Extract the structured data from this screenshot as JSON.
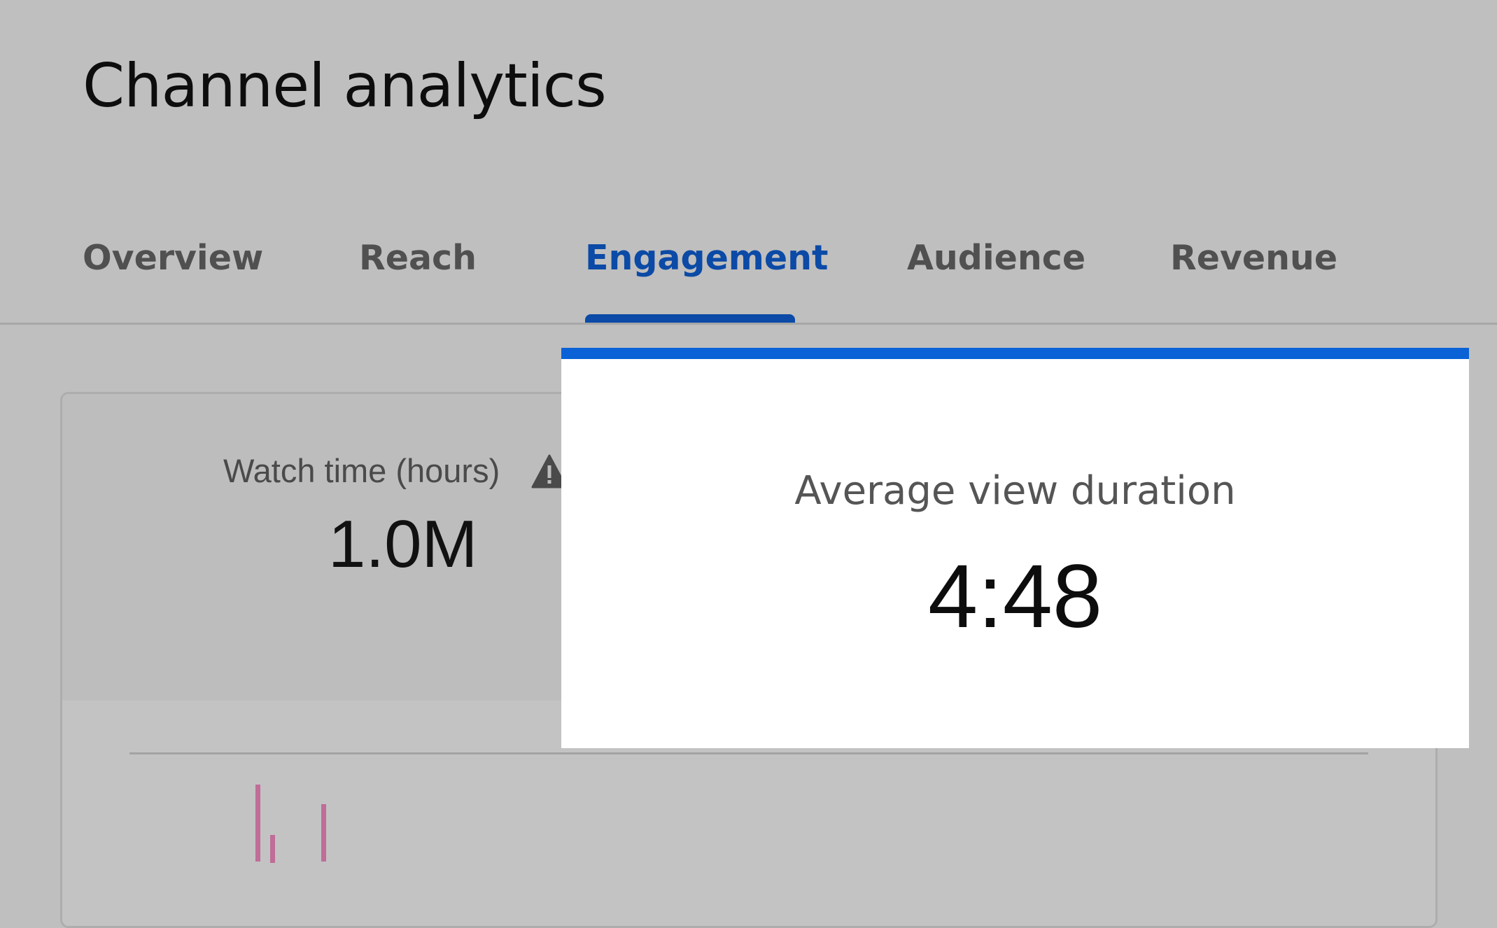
{
  "header": {
    "title": "Channel analytics"
  },
  "tabs": [
    {
      "label": "Overview",
      "active": false
    },
    {
      "label": "Reach",
      "active": false
    },
    {
      "label": "Engagement",
      "active": true
    },
    {
      "label": "Audience",
      "active": false
    },
    {
      "label": "Revenue",
      "active": false
    }
  ],
  "metric_card": {
    "label": "Watch time (hours)",
    "value": "1.0M",
    "icon": "warning-icon"
  },
  "popup": {
    "label": "Average view duration",
    "value": "4:48"
  },
  "colors": {
    "accent": "#0b4aa6",
    "popup_accent": "#0a62d6",
    "chart_bar": "#c06d98"
  }
}
